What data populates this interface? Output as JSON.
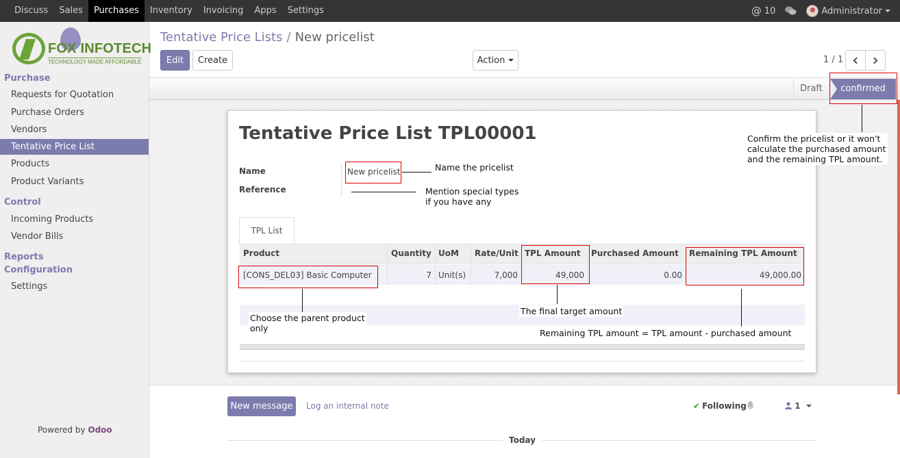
{
  "topbar": {
    "menu": [
      "Discuss",
      "Sales",
      "Purchases",
      "Inventory",
      "Invoicing",
      "Apps",
      "Settings"
    ],
    "active": "Purchases",
    "mentions_count": "10",
    "user": "Administrator"
  },
  "logo": {
    "name": "FOX INFOTECH",
    "tagline": "TECHNOLOGY MADE AFFORDABLE"
  },
  "sidebar": {
    "sections": [
      {
        "title": "Purchase",
        "items": [
          "Requests for Quotation",
          "Purchase Orders",
          "Vendors",
          "Tentative Price List",
          "Products",
          "Product Variants"
        ]
      },
      {
        "title": "Control",
        "items": [
          "Incoming Products",
          "Vendor Bills"
        ]
      },
      {
        "title": "Reports",
        "items": []
      },
      {
        "title": "Configuration",
        "items": [
          "Settings"
        ]
      }
    ],
    "active_item": "Tentative Price List",
    "powered_by_prefix": "Powered by",
    "powered_by_brand": "Odoo"
  },
  "breadcrumb": {
    "parent": "Tentative Price Lists",
    "separator": "/",
    "current": "New pricelist"
  },
  "toolbar": {
    "edit_label": "Edit",
    "create_label": "Create",
    "action_label": "Action",
    "pager": "1 / 1"
  },
  "status": {
    "stages": [
      "Draft",
      "confirmed"
    ],
    "current": "confirmed"
  },
  "form": {
    "title": "Tentative Price List TPL00001",
    "name_label": "Name",
    "name_value": "New pricelist",
    "reference_label": "Reference",
    "reference_value": ""
  },
  "tabs": [
    "TPL List"
  ],
  "table": {
    "headers": [
      "Product",
      "Quantity",
      "UoM",
      "Rate/Unit",
      "TPL Amount",
      "Purchased Amount",
      "Remaining TPL Amount"
    ],
    "rows": [
      [
        "[CONS_DEL03] Basic Computer",
        "7",
        "Unit(s)",
        "7,000",
        "49,000",
        "0.00",
        "49,000.00"
      ]
    ]
  },
  "annotations": {
    "confirm": [
      "Confirm the pricelist or it won't",
      "calculate the purchased amount",
      "and the remaining TPL amount."
    ],
    "name": "Name the pricelist",
    "reference": [
      "Mention special types",
      "if you have any"
    ],
    "product": [
      "Choose the parent product",
      "only"
    ],
    "tpl_amount": "The final target amount",
    "remaining": "Remaining TPL amount = TPL amount - purchased amount"
  },
  "chatter": {
    "new_message_label": "New message",
    "log_note_label": "Log an internal note",
    "following_label": "Following",
    "followers_count": "1",
    "today_label": "Today"
  },
  "colors": {
    "accent": "#7c7bad",
    "topbar": "#353535",
    "annotation_red": "#dd0000"
  }
}
